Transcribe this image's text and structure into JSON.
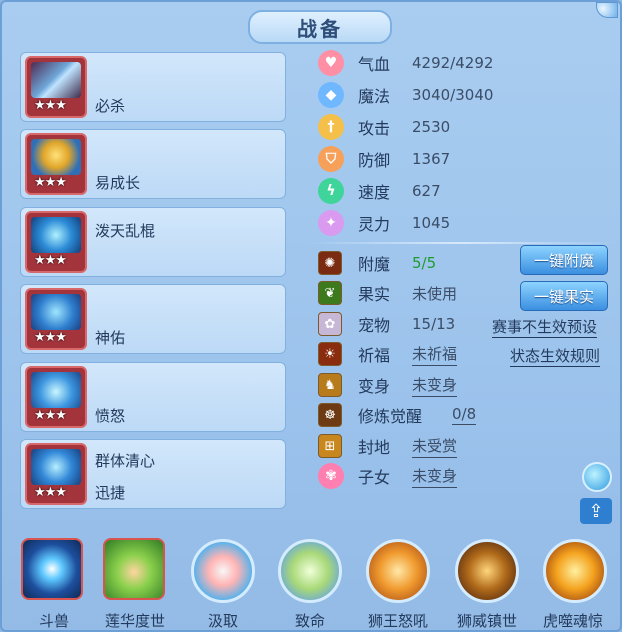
{
  "title": "战备",
  "equipment": [
    {
      "icon": "spear-weapon-icon",
      "stars": "★★★",
      "label": "必杀",
      "label2": ""
    },
    {
      "icon": "golden-helmet-icon",
      "stars": "★★★",
      "label": "易成长",
      "label2": ""
    },
    {
      "icon": "blue-armor-icon",
      "stars": "★★★",
      "label": "泼天乱棍",
      "label2": ""
    },
    {
      "icon": "blue-ring-icon",
      "stars": "★★★",
      "label": "神佑",
      "label2": ""
    },
    {
      "icon": "blue-crown-icon",
      "stars": "★★★",
      "label": "愤怒",
      "label2": ""
    },
    {
      "icon": "blue-cloak-icon",
      "stars": "★★★",
      "label": "群体清心",
      "label2": "迅捷"
    }
  ],
  "stats": [
    {
      "icon": "heart-icon",
      "label": "气血",
      "value": "4292/4292"
    },
    {
      "icon": "diamond-icon",
      "label": "魔法",
      "value": "3040/3040"
    },
    {
      "icon": "sword-icon",
      "label": "攻击",
      "value": "2530"
    },
    {
      "icon": "shield-icon",
      "label": "防御",
      "value": "1367"
    },
    {
      "icon": "lightning-icon",
      "label": "速度",
      "value": "627"
    },
    {
      "icon": "spirit-icon",
      "label": "灵力",
      "value": "1045"
    }
  ],
  "extras": [
    {
      "icon": "enchant-icon",
      "label": "附魔",
      "value": "5/5"
    },
    {
      "icon": "fruit-icon",
      "label": "果实",
      "value": "未使用"
    },
    {
      "icon": "pet-icon",
      "label": "宠物",
      "value": "15/13"
    },
    {
      "icon": "blessing-icon",
      "label": "祈福",
      "value": "未祈福"
    },
    {
      "icon": "transform-icon",
      "label": "变身",
      "value": "未变身"
    },
    {
      "icon": "cultivation-icon",
      "label": "修炼觉醒",
      "value": "0/8"
    },
    {
      "icon": "seal-icon",
      "label": "封地",
      "value": "未受赏"
    },
    {
      "icon": "child-icon",
      "label": "子女",
      "value": "未变身"
    }
  ],
  "buttons": {
    "one_click_enchant": "一键附魔",
    "one_click_fruit": "一键果实"
  },
  "links": {
    "event_preset": "赛事不生效预设",
    "status_rules": "状态生效规则"
  },
  "skills": [
    {
      "icon": "beast-fight-icon",
      "label": "斗兽"
    },
    {
      "icon": "lotus-hand-icon",
      "label": "莲华度世"
    },
    {
      "icon": "absorb-icon",
      "label": "汲取"
    },
    {
      "icon": "fatal-icon",
      "label": "致命"
    },
    {
      "icon": "lion-roar-icon",
      "label": "狮王怒吼"
    },
    {
      "icon": "lion-guard-icon",
      "label": "狮威镇世"
    },
    {
      "icon": "tiger-soul-icon",
      "label": "虎噬魂惊"
    }
  ],
  "colors": {
    "enchant_value": "#1f9b2e",
    "slot_frame": "#a3343b",
    "button": "#3b8fe0"
  }
}
